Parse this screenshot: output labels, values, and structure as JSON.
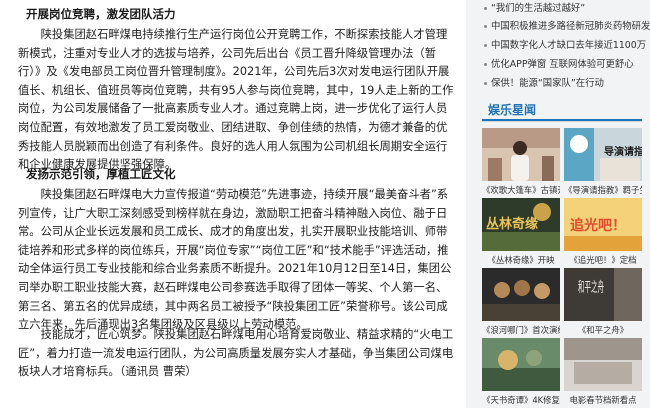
{
  "article": {
    "sections": [
      {
        "heading": "开展岗位竞聘，激发团队活力",
        "paragraph": "陕投集团赵石畔煤电持续推行生产运行岗位公开竞聘工作，不断探索技能人才管理新模式，注重对专业人才的选拔与培养，公司先后出台《员工晋升降级管理办法（暂行）》及《发电部员工岗位晋升管理制度》。2021年，公司先后3次对发电运行团队开展值长、机组长、值班员等岗位竞聘，共有95人参与岗位竞聘，其中，19人走上新的工作岗位，为公司发展储备了一批高素质专业人才。通过竞聘上岗，进一步优化了运行人员岗位配置，有效地激发了员工爱岗敬业、团结进取、争创佳绩的热情，为德才兼备的优秀技能人员脱颖而出创造了有利条件。良好的选人用人氛围为公司机组长周期安全运行和企业健康发展提供坚强保障。"
      },
      {
        "heading": "发扬示范引领，厚植工匠文化",
        "paragraph": "陕投集团赵石畔煤电大力宣传报道“劳动模范”先进事迹，持续开展“最美奋斗者”系列宣传，让广大职工深刻感受到榜样就在身边，激励职工把奋斗精神融入岗位、融于日常。公司从企业长远发展和员工成长、成才的角度出发，扎实开展职业技能培训、师带徒培养和形式多样的岗位练兵，开展“岗位专家”“岗位工匠”和“技术能手”评选活动，推动全体运行员工专业技能和综合业务素质不断提升。2021年10月12日至14日，集团公司举办职工职业技能大赛，赵石畔煤电公司参赛选手取得了团体一等奖、个人第一名、第三名、第五名的优异成绩，其中两名员工被授予“陕投集团工匠”荣誉称号。该公司成立六年来，先后涌现出3名集团级及区县级以上劳动模范。"
      },
      {
        "heading": "",
        "paragraph": "技能成才，匠心筑梦。陕投集团赵石畔煤电用心培育爱岗敬业、精益求精的“火电工匠”，着力打造一流发电运行团队，为公司高质量发展夯实人才基础，争当集团公司煤电板块人才培育标兵。（通讯员 曹荣）"
      }
    ]
  },
  "sidebar": {
    "news": [
      "“我们的生活越过越好”",
      "中国积极推进多路径新冠肺炎药物研发",
      "中国数字化人才缺口去年接近1100万",
      "优化APP弹窗 互联网体验可更舒心",
      "保供！能源“国家队”在行动"
    ],
    "section_title": "娱乐星闻",
    "cards": [
      {
        "caption": "《欢歌大篷车》古镇开唱",
        "thumb_text": ""
      },
      {
        "caption": "《导演请指教》羁子生活",
        "thumb_text": "导演请指"
      },
      {
        "caption": "《丛林奇缘》开映",
        "thumb_text": "丛林奇缘"
      },
      {
        "caption": "《追光吧！》定档",
        "thumb_text": "追光吧！"
      },
      {
        "caption": "《浪河哪门》首次演绎",
        "thumb_text": ""
      },
      {
        "caption": "《和平之舟》",
        "thumb_text": "和平之舟"
      },
      {
        "caption": "《天书奇谭》4K修复",
        "thumb_text": ""
      },
      {
        "caption": "电影春节档新看点",
        "thumb_text": ""
      }
    ]
  },
  "colors": {
    "accent": "#1e73b8",
    "sidebar_bg": "#f2f3f5",
    "text": "#222222"
  }
}
